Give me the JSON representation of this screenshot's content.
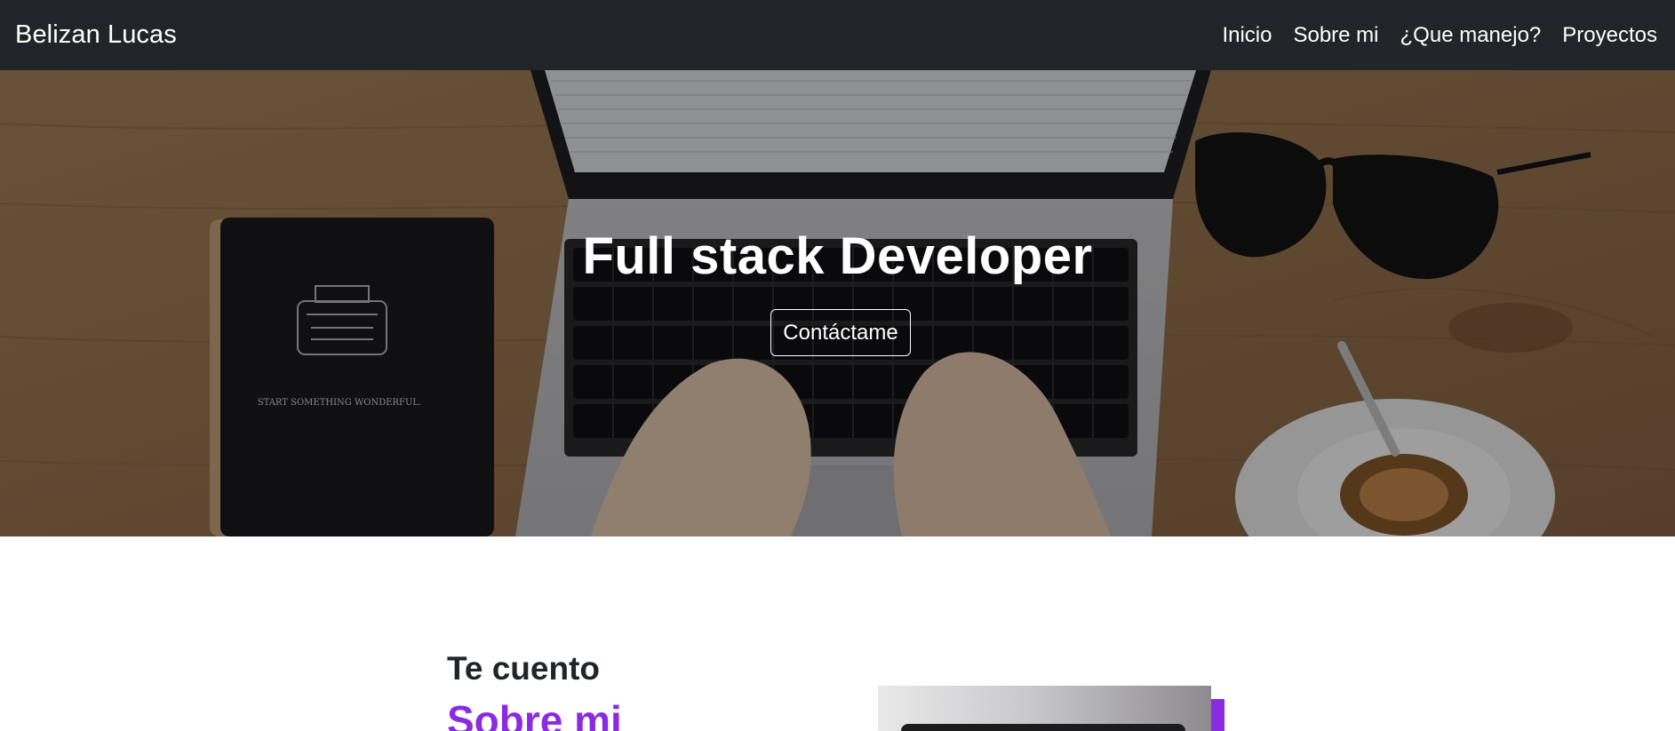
{
  "navbar": {
    "brand": "Belizan Lucas",
    "links": [
      "Inicio",
      "Sobre mi",
      "¿Que manejo?",
      "Proyectos"
    ]
  },
  "hero": {
    "title": "Full stack Developer",
    "button_label": "Contáctame",
    "notebook_text": "START SOMETHING WONDERFUL."
  },
  "about": {
    "kicker": "Te cuento",
    "heading": "Sobre mi"
  },
  "colors": {
    "navbar_bg": "#212529",
    "accent": "#8a2be2",
    "text_dark": "#212529"
  }
}
